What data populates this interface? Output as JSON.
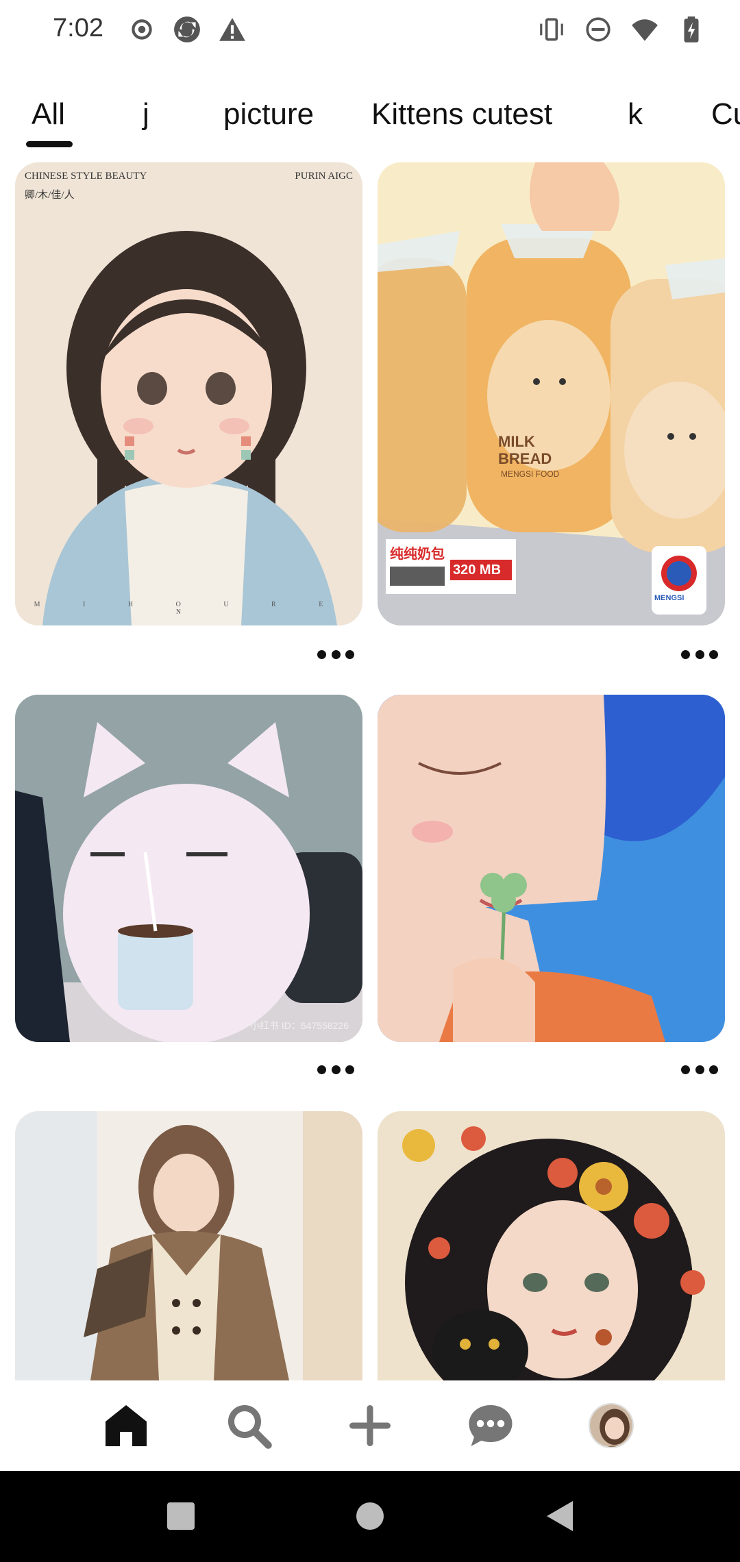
{
  "status_bar": {
    "time": "7:02",
    "left_icons": [
      "record-icon",
      "sync-app-icon",
      "warning-icon"
    ],
    "right_icons": [
      "vibrate-icon",
      "do-not-disturb-icon",
      "wifi-icon",
      "battery-icon"
    ]
  },
  "tabs": [
    {
      "label": "All",
      "active": true
    },
    {
      "label": "j",
      "active": false
    },
    {
      "label": "picture",
      "active": false
    },
    {
      "label": "Kittens cutest",
      "active": false
    },
    {
      "label": "k",
      "active": false
    },
    {
      "label": "Cu",
      "active": false
    }
  ],
  "pins": {
    "p1": {
      "title_line": "CHINESE STYLE BEAUTY",
      "sub_line": "卿/木/佳/人",
      "brand": "PURIN AIGC",
      "footer": "M I H O U R E N"
    },
    "p2": {
      "label_1": "MILK",
      "label_2": "BREAD",
      "maker": "MENGSI FOOD",
      "tag_cn": "纯纯奶包",
      "tag_size": "320 MB",
      "logo_text": "MENGSI"
    },
    "p3": {
      "watermark": "小红书 ID：547558226"
    },
    "p4": {},
    "p5": {},
    "p6": {}
  },
  "more_options_icon": "more-horizontal-icon",
  "bottom_nav": [
    "home-icon",
    "search-icon",
    "create-plus-icon",
    "messages-icon",
    "profile-avatar"
  ],
  "system_nav": [
    "recents-square-icon",
    "home-circle-icon",
    "back-triangle-icon"
  ],
  "colors": {
    "text": "#111111",
    "background": "#ffffff",
    "nav_icon_gray": "#767676"
  }
}
